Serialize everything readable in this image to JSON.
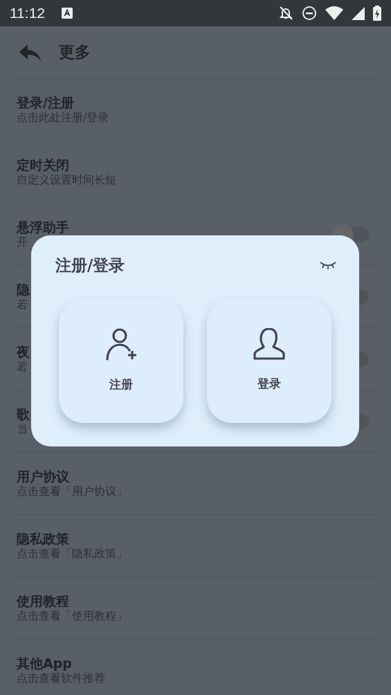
{
  "status_bar": {
    "time": "11:12"
  },
  "header": {
    "title": "更多"
  },
  "rows": [
    {
      "kind": "plain",
      "title": "登录/注册",
      "subtitle": "点击此处注册/登录"
    },
    {
      "kind": "plain",
      "title": "定时关闭",
      "subtitle": "自定义设置时间长短"
    },
    {
      "kind": "switch",
      "title": "悬浮助手",
      "subtitle": "开",
      "on": false
    },
    {
      "kind": "switch",
      "title": "隐",
      "subtitle": "若",
      "on": false
    },
    {
      "kind": "switch",
      "title": "夜",
      "subtitle": "若",
      "on": false
    },
    {
      "kind": "switch",
      "title": "歌",
      "subtitle": "当",
      "on": false
    },
    {
      "kind": "plain",
      "title": "用户协议",
      "subtitle": "点击查看「用户协议」"
    },
    {
      "kind": "plain",
      "title": "隐私政策",
      "subtitle": "点击查看「隐私政策」"
    },
    {
      "kind": "plain",
      "title": "使用教程",
      "subtitle": "点击查看「使用教程」"
    },
    {
      "kind": "plain",
      "title": "其他App",
      "subtitle": "点击查看软件推荐"
    }
  ],
  "dialog": {
    "title": "注册/登录",
    "options": [
      {
        "kind": "register",
        "label": "注册"
      },
      {
        "kind": "login",
        "label": "登录"
      }
    ]
  }
}
